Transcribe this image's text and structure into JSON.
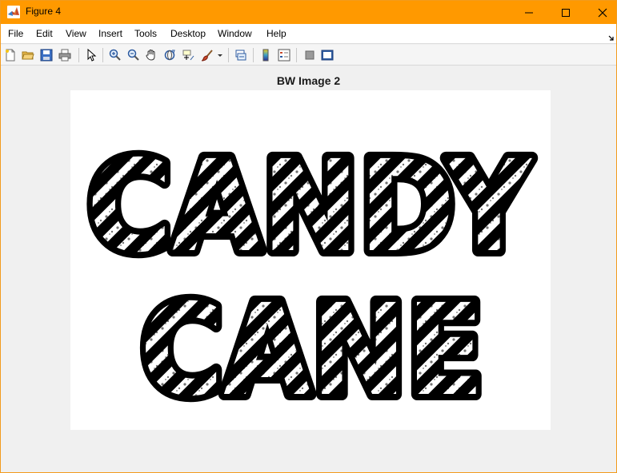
{
  "window": {
    "title": "Figure 4",
    "accent_color": "#ff9900",
    "app_icon": "matlab-icon",
    "controls": [
      "minimize-icon",
      "maximize-icon",
      "close-icon"
    ]
  },
  "menu": {
    "items": [
      "File",
      "Edit",
      "View",
      "Insert",
      "Tools",
      "Desktop",
      "Window",
      "Help"
    ],
    "dock_icon": "dock-arrow-icon"
  },
  "toolbar": {
    "icons": [
      "new-figure-icon",
      "open-file-icon",
      "save-icon",
      "print-icon",
      "select-arrow-icon",
      "zoom-in-icon",
      "zoom-out-icon",
      "pan-hand-icon",
      "rotate-3d-icon",
      "data-cursor-icon",
      "brush-icon",
      "brush-dropdown-icon",
      "link-plot-icon",
      "colorbar-icon",
      "legend-icon",
      "hide-plot-tools-icon",
      "show-plot-tools-icon"
    ]
  },
  "figure": {
    "axes_title": "BW Image 2",
    "image_text_lines": [
      "CANDY",
      "CANE"
    ],
    "image_colors": {
      "ink": "#000000",
      "paper": "#ffffff"
    }
  }
}
